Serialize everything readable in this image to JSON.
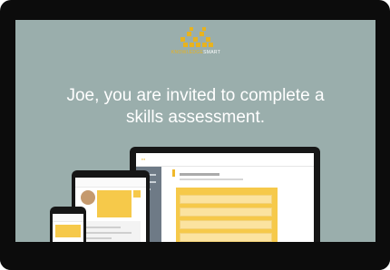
{
  "brand": {
    "name_part1": "KNOWLEDGE",
    "name_part2": "SMART",
    "accent_color": "#e8b31e",
    "background_color": "#9aaeac"
  },
  "headline": {
    "line1": "Joe, you are invited to complete a",
    "line2": "skills assessment."
  },
  "devices": [
    "laptop",
    "tablet",
    "phone"
  ]
}
